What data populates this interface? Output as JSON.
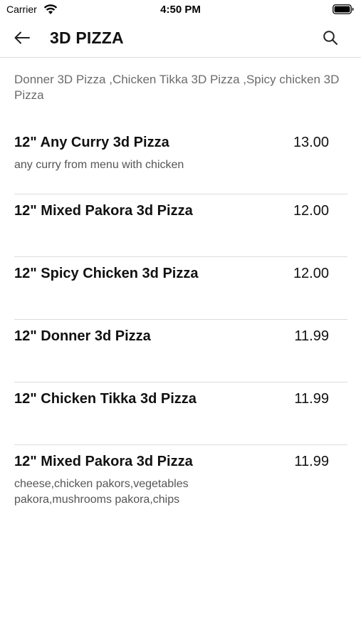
{
  "status_bar": {
    "carrier": "Carrier",
    "time": "4:50 PM"
  },
  "nav": {
    "title": "3D PIZZA",
    "back_icon": "arrow-left-icon",
    "search_icon": "search-icon"
  },
  "category": {
    "description": "Donner 3D Pizza ,Chicken Tikka 3D Pizza ,Spicy chicken 3D Pizza"
  },
  "items": [
    {
      "name": "12\" Any Curry 3d Pizza",
      "price": "13.00",
      "description": "any curry from menu with chicken"
    },
    {
      "name": "12\" Mixed Pakora 3d Pizza",
      "price": "12.00",
      "description": ""
    },
    {
      "name": "12\" Spicy Chicken 3d Pizza",
      "price": "12.00",
      "description": ""
    },
    {
      "name": "12\" Donner 3d Pizza",
      "price": "11.99",
      "description": ""
    },
    {
      "name": "12\" Chicken Tikka 3d Pizza",
      "price": "11.99",
      "description": ""
    },
    {
      "name": "12\" Mixed Pakora 3d Pizza",
      "price": "11.99",
      "description": "cheese,chicken pakors,vegetables pakora,mushrooms pakora,chips"
    }
  ]
}
